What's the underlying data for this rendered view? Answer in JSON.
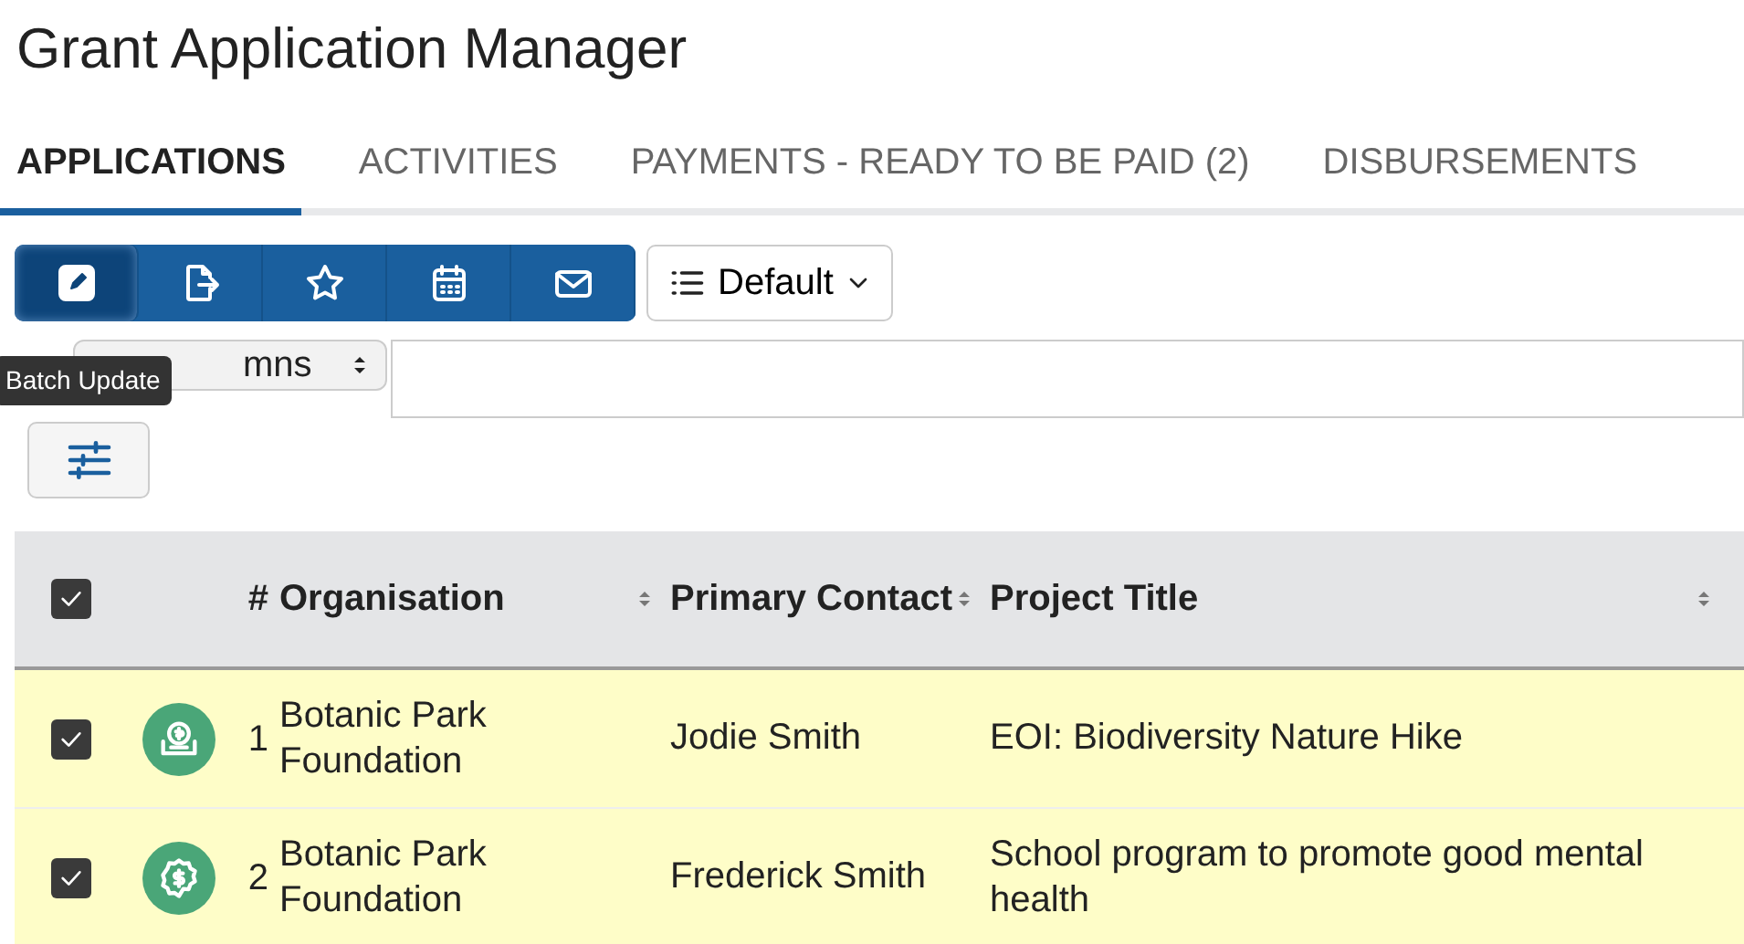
{
  "title": "Grant Application Manager",
  "tabs": [
    {
      "label": "APPLICATIONS",
      "selected": true
    },
    {
      "label": "ACTIVITIES",
      "selected": false
    },
    {
      "label": "PAYMENTS - READY TO BE PAID (2)",
      "selected": false
    },
    {
      "label": "DISBURSEMENTS",
      "selected": false
    }
  ],
  "toolbar": {
    "buttons": [
      {
        "kind": "edit",
        "selected": true
      },
      {
        "kind": "export",
        "selected": false
      },
      {
        "kind": "star",
        "selected": false
      },
      {
        "kind": "calendar",
        "selected": false
      },
      {
        "kind": "mail",
        "selected": false
      }
    ],
    "view_dropdown": "Default",
    "tooltip": "Batch Update"
  },
  "search": {
    "column_select": "mns"
  },
  "table": {
    "all_checked": true,
    "columns": [
      "#",
      "Organisation",
      "Primary Contact",
      "Project Title"
    ],
    "rows": [
      {
        "checked": true,
        "kind": "tray",
        "number": "1",
        "organisation": "Botanic Park Foundation",
        "contact": "Jodie Smith",
        "project": "EOI: Biodiversity Nature Hike"
      },
      {
        "checked": true,
        "kind": "seal",
        "number": "2",
        "organisation": "Botanic Park Foundation",
        "contact": "Frederick Smith",
        "project": "School program to promote good mental health"
      }
    ]
  }
}
